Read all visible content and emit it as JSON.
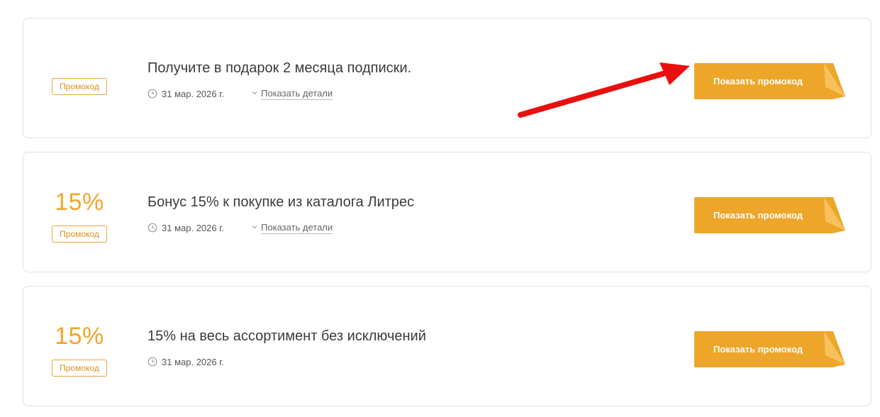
{
  "promo_button_label": "Показать промокод",
  "details_label": "Показать детали",
  "colors": {
    "accent": "#f0a62a",
    "button": "#eda52a",
    "button_fold": "#f7c25c",
    "annotation_arrow": "#e8100f"
  },
  "offers": [
    {
      "discount": "",
      "badge": "Промокод",
      "title": "Получите в подарок 2 месяца подписки.",
      "date": "31 мар. 2026 г.",
      "has_details": true
    },
    {
      "discount": "15%",
      "badge": "Промокод",
      "title": "Бонус 15% к покупке из каталога Литрес",
      "date": "31 мар. 2026 г.",
      "has_details": true
    },
    {
      "discount": "15%",
      "badge": "Промокод",
      "title": "15% на весь ассортимент без исключений",
      "date": "31 мар. 2026 г.",
      "has_details": false
    }
  ]
}
